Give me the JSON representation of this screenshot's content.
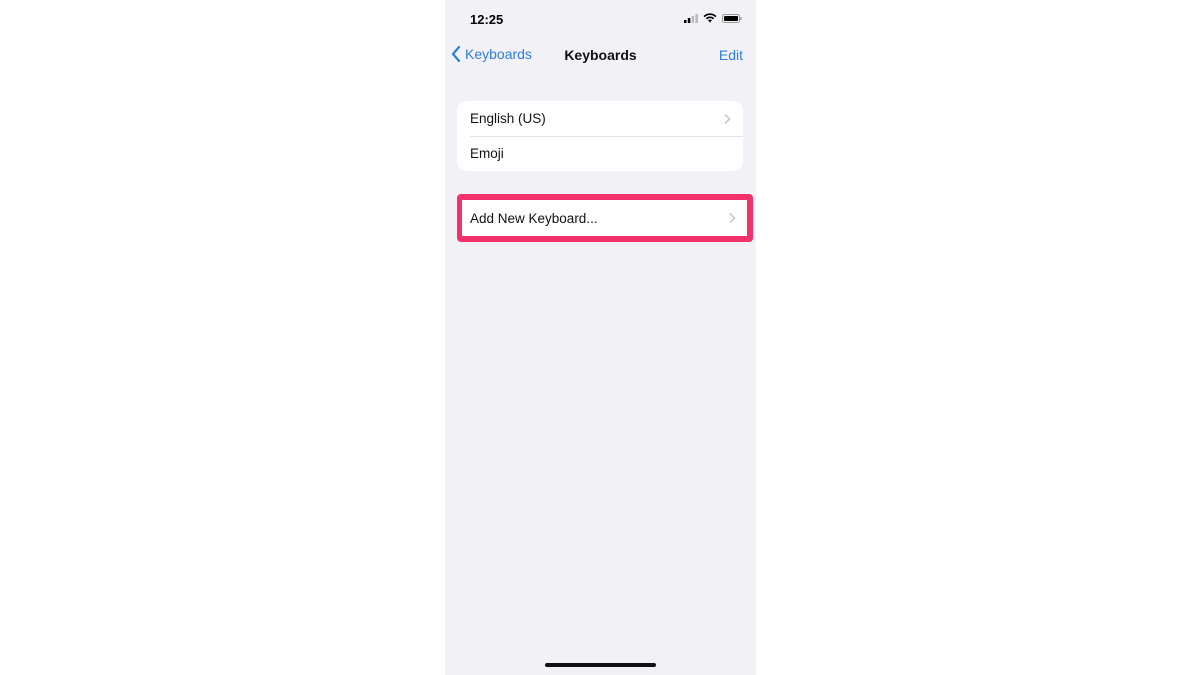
{
  "status_bar": {
    "time": "12:25",
    "icons": [
      "signal-icon",
      "wifi-icon",
      "battery-icon"
    ]
  },
  "nav": {
    "back_label": "Keyboards",
    "title": "Keyboards",
    "edit_label": "Edit"
  },
  "keyboards": [
    {
      "label": "English (US)",
      "has_chevron": true
    },
    {
      "label": "Emoji",
      "has_chevron": false
    }
  ],
  "add_keyboard": {
    "label": "Add New Keyboard...",
    "highlight_color": "#f2336b"
  },
  "colors": {
    "accent": "#2f7fd8",
    "background": "#f2f1f6"
  }
}
